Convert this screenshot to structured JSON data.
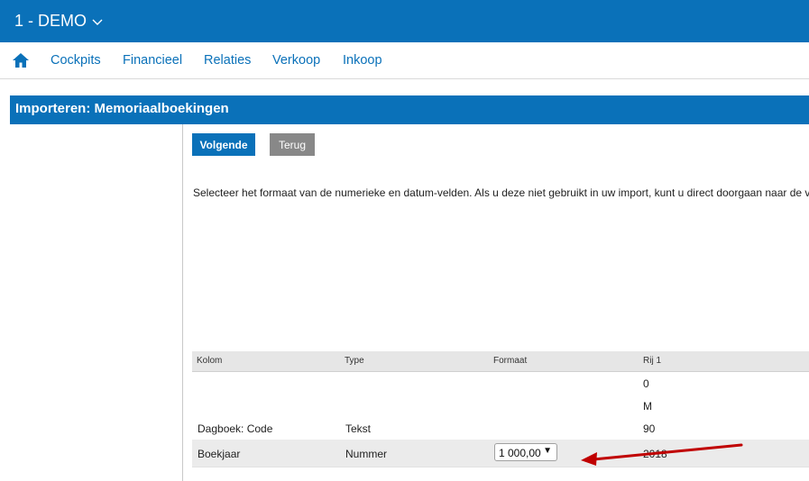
{
  "header": {
    "company": "1 - DEMO"
  },
  "nav": {
    "items": [
      "Cockpits",
      "Financieel",
      "Relaties",
      "Verkoop",
      "Inkoop"
    ]
  },
  "page": {
    "title": "Importeren: Memoriaalboekingen"
  },
  "buttons": {
    "next": "Volgende",
    "back": "Terug"
  },
  "instruction": "Selecteer het formaat van de numerieke en datum-velden. Als u deze niet gebruikt in uw import, kunt u direct doorgaan naar de v",
  "table": {
    "headers": {
      "kolom": "Kolom",
      "type": "Type",
      "formaat": "Formaat",
      "rij1": "Rij 1"
    },
    "rows": [
      {
        "kolom": "",
        "type": "",
        "formaat": "",
        "rij1": "0"
      },
      {
        "kolom": "",
        "type": "",
        "formaat": "",
        "rij1": "M"
      },
      {
        "kolom": "Dagboek: Code",
        "type": "Tekst",
        "formaat": "",
        "rij1": "90"
      },
      {
        "kolom": "Boekjaar",
        "type": "Nummer",
        "formaat": "1 000,00",
        "rij1": "2018"
      }
    ]
  },
  "colors": {
    "primary": "#0a71b9",
    "secondary_button": "#888888",
    "annotation_arrow": "#c00000"
  },
  "icons": {
    "home": "home-icon",
    "company_dropdown": "chevron-down-icon",
    "select_caret": "caret-down-icon"
  }
}
